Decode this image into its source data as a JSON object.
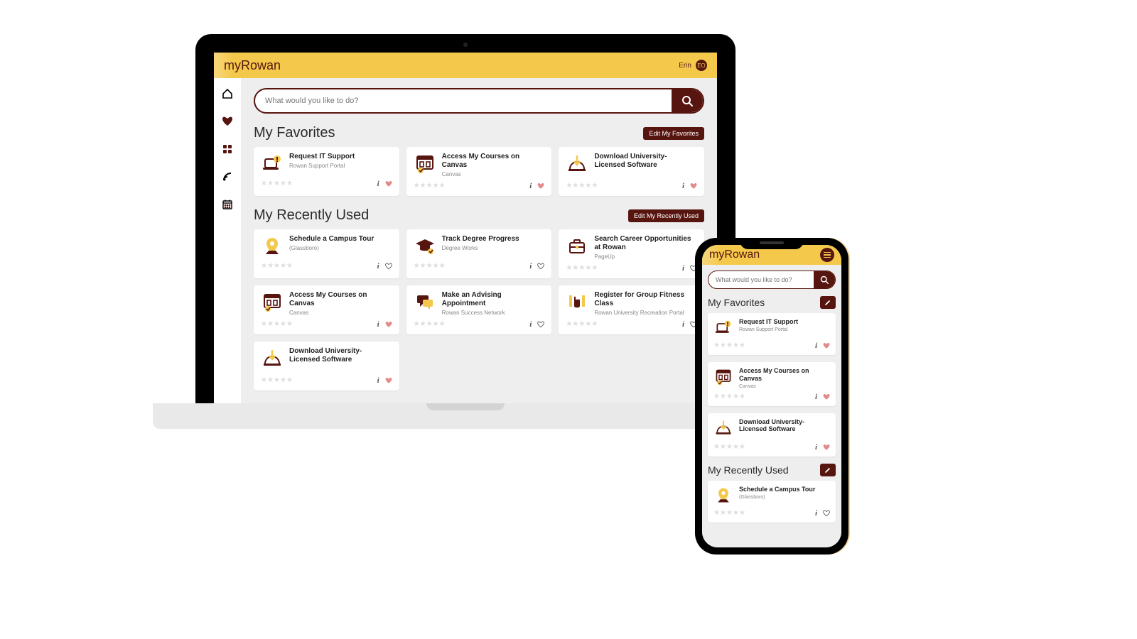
{
  "brand": "myRowan",
  "user": {
    "name": "Erin",
    "initials": "EO"
  },
  "search": {
    "placeholder": "What would you like to do?"
  },
  "colors": {
    "primary": "#57150f",
    "accent": "#F4C94B",
    "heart_fav": "#E28B8B",
    "heart_outline": "#555"
  },
  "sections": {
    "favorites": {
      "title": "My Favorites",
      "edit_label": "Edit My Favorites",
      "items": [
        {
          "icon": "laptop-alert",
          "title": "Request IT Support",
          "subtitle": "Rowan Support Portal",
          "favorited": true
        },
        {
          "icon": "canvas",
          "title": "Access My Courses on Canvas",
          "subtitle": "Canvas",
          "favorited": true
        },
        {
          "icon": "download-arch",
          "title": "Download University-Licensed Software",
          "subtitle": "",
          "favorited": true
        }
      ]
    },
    "recent": {
      "title": "My Recently Used",
      "edit_label": "Edit My Recently Used",
      "items": [
        {
          "icon": "map-pin",
          "title": "Schedule a Campus Tour",
          "subtitle": "(Glassboro)",
          "favorited": false
        },
        {
          "icon": "grad-cap",
          "title": "Track Degree Progress",
          "subtitle": "Degree Works",
          "favorited": false
        },
        {
          "icon": "briefcase",
          "title": "Search Career Opportunities at Rowan",
          "subtitle": "PageUp",
          "favorited": false
        },
        {
          "icon": "canvas",
          "title": "Access My Courses on Canvas",
          "subtitle": "Canvas",
          "favorited": true
        },
        {
          "icon": "chat",
          "title": "Make an Advising Appointment",
          "subtitle": "Rowan Success Network",
          "favorited": false
        },
        {
          "icon": "fist",
          "title": "Register for Group Fitness Class",
          "subtitle": "Rowan University Recreation Portal",
          "favorited": false
        },
        {
          "icon": "download-arch",
          "title": "Download University-Licensed Software",
          "subtitle": "",
          "favorited": true
        }
      ]
    }
  },
  "phone": {
    "favorites": {
      "title": "My Favorites",
      "items": [
        {
          "icon": "laptop-alert",
          "title": "Request IT Support",
          "subtitle": "Rowan Support Portal",
          "favorited": true
        },
        {
          "icon": "canvas",
          "title": "Access My Courses on Canvas",
          "subtitle": "Canvas",
          "favorited": true
        },
        {
          "icon": "download-arch",
          "title": "Download University-Licensed Software",
          "subtitle": "",
          "favorited": true
        }
      ]
    },
    "recent": {
      "title": "My Recently Used",
      "items": [
        {
          "icon": "map-pin",
          "title": "Schedule a Campus Tour",
          "subtitle": "(Glassboro)",
          "favorited": false
        }
      ]
    }
  }
}
